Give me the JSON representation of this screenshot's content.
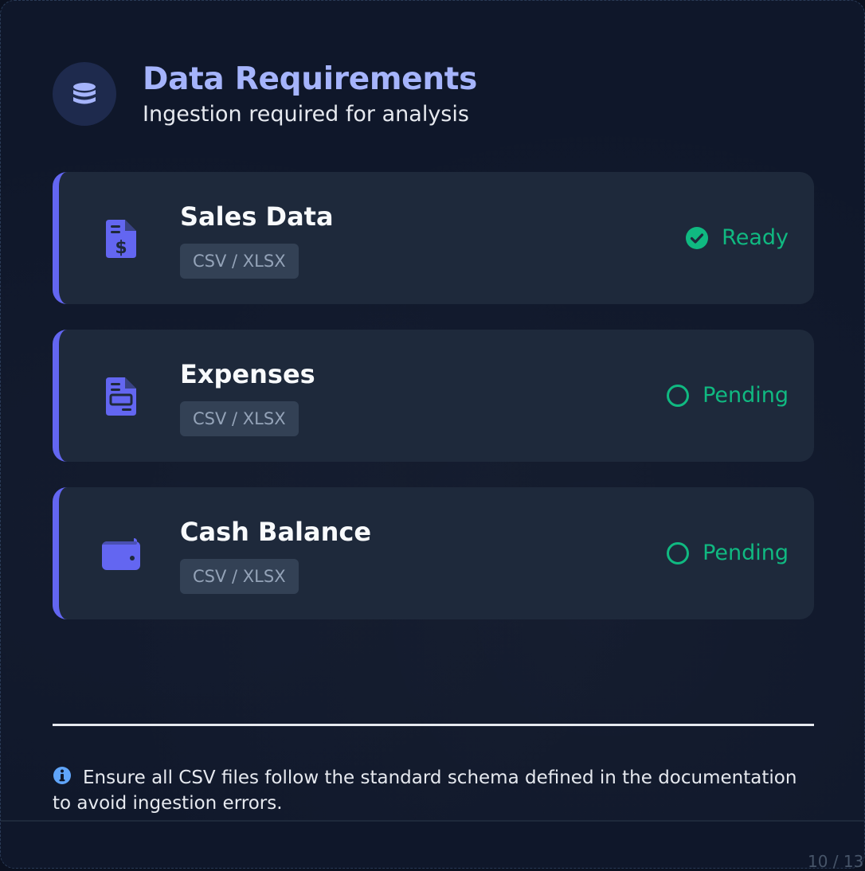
{
  "header": {
    "icon": "database-icon",
    "title": "Data Requirements",
    "subtitle": "Ingestion required for analysis"
  },
  "accent_color": "#6366f1",
  "status_color": "#10b981",
  "cards": [
    {
      "icon": "invoice-dollar-icon",
      "title": "Sales Data",
      "format": "CSV / XLSX",
      "status": "Ready",
      "status_icon": "check-circle-icon"
    },
    {
      "icon": "receipt-icon",
      "title": "Expenses",
      "format": "CSV / XLSX",
      "status": "Pending",
      "status_icon": "empty-circle-icon"
    },
    {
      "icon": "wallet-icon",
      "title": "Cash Balance",
      "format": "CSV / XLSX",
      "status": "Pending",
      "status_icon": "empty-circle-icon"
    }
  ],
  "note": {
    "icon": "info-icon",
    "text": "Ensure all CSV files follow the standard schema defined in the documentation to avoid ingestion errors."
  },
  "pagination": "10 / 13"
}
